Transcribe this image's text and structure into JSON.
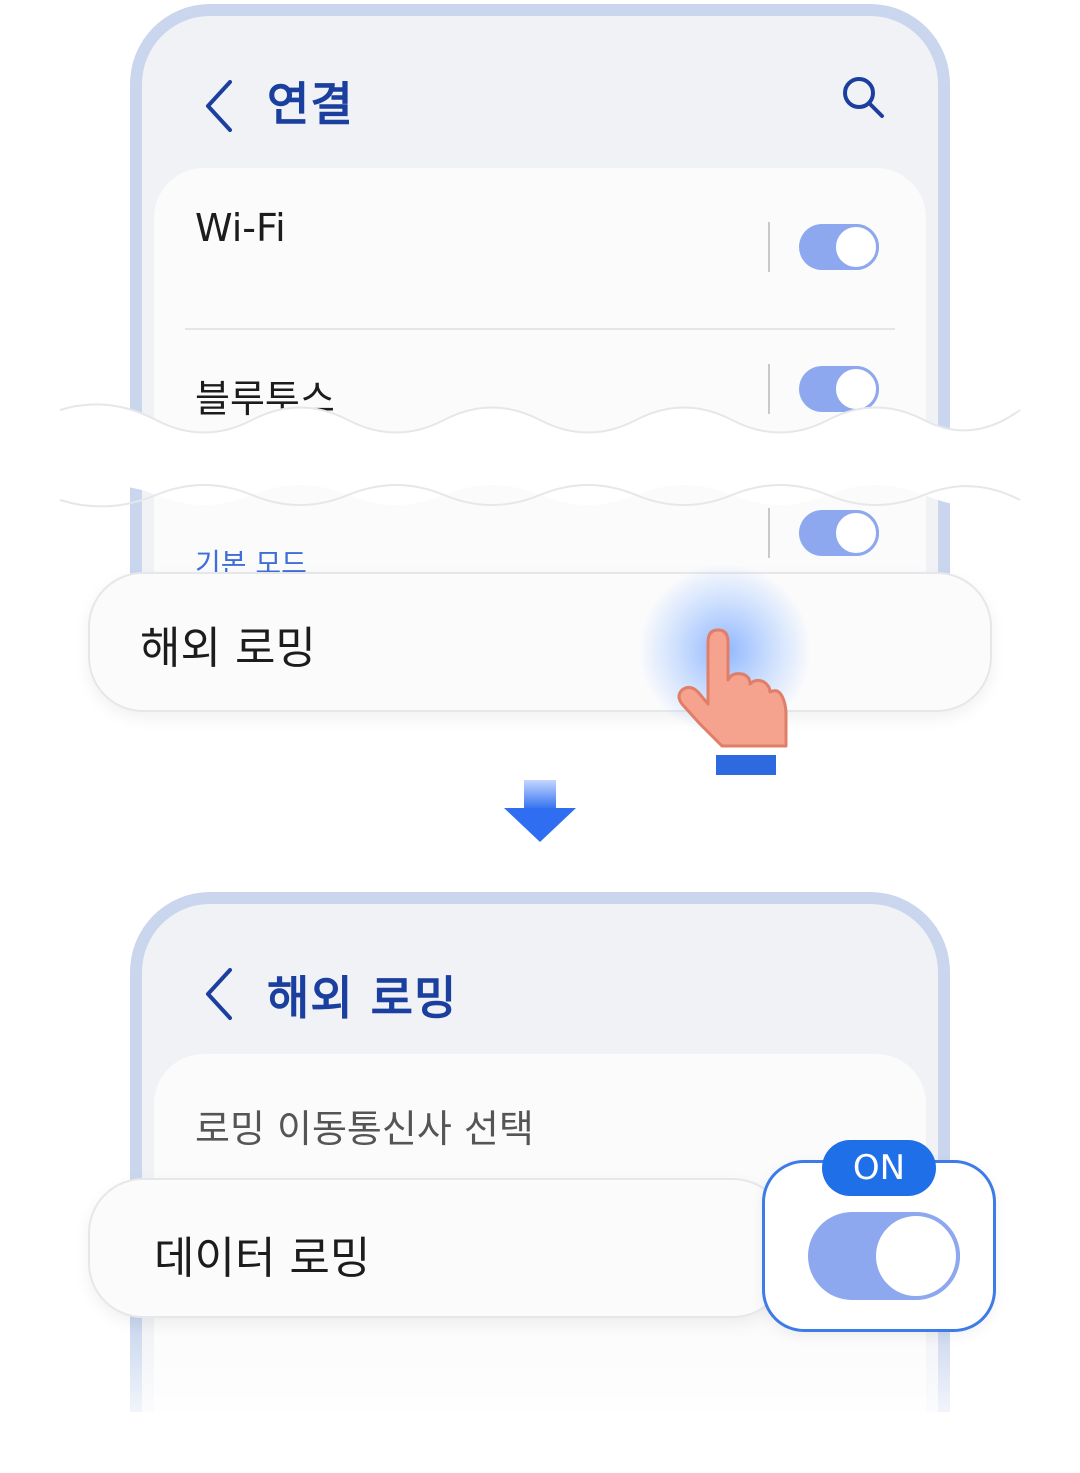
{
  "top_screen": {
    "title": "연결",
    "rows": {
      "wifi": "Wi-Fi",
      "bluetooth": "블루투스",
      "nfc_sub": "기본 모드"
    },
    "highlighted_item": "해외 로밍"
  },
  "bottom_screen": {
    "title": "해외 로밍",
    "rows": {
      "carrier": "로밍 이동통신사 선택",
      "data_roaming": "데이터 로밍"
    },
    "badge": "ON"
  },
  "colors": {
    "accent_title": "#1b3f9e",
    "toggle_on": "#8ea8ef",
    "badge": "#1f6fe8",
    "phone_frame": "#c9d6ee"
  },
  "icons": [
    "back-arrow-icon",
    "search-icon",
    "pointing-hand-icon",
    "down-arrow-icon"
  ]
}
